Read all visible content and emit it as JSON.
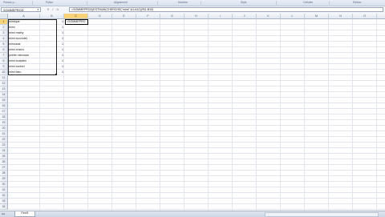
{
  "ribbon": {
    "groups": [
      "Presse-p...",
      "Police",
      "Alignement",
      "Nombre",
      "Style",
      "Cellules",
      "Édition"
    ]
  },
  "formula_bar": {
    "name_box": "SOMMEPROD",
    "formula": "=SOMMEPROD(ESTNUM(CHERCHE(\"mimi\";A1:A10))*B1:B10)",
    "icons": [
      "cancel-icon",
      "enter-icon",
      "function-icon"
    ]
  },
  "columns": [
    "A",
    "B",
    "C",
    "D",
    "E",
    "F",
    "G",
    "H",
    "I",
    "J",
    "K",
    "L",
    "M",
    "N",
    "O",
    "P",
    "Q",
    "R",
    "S"
  ],
  "rows": [
    "1",
    "2",
    "3",
    "4",
    "5",
    "6",
    "7",
    "8",
    "9",
    "10",
    "11",
    "12",
    "13",
    "14",
    "15",
    "16",
    "17",
    "18",
    "19",
    "20",
    "21",
    "22",
    "23",
    "24",
    "25",
    "26",
    "27",
    "28",
    "29",
    "30",
    "31",
    "32",
    "33",
    "34"
  ],
  "cells": [
    {
      "a": "mimique",
      "b": "1"
    },
    {
      "a": "mimi",
      "b": "1"
    },
    {
      "a": "mimi mathy",
      "b": "1"
    },
    {
      "a": "mimi cucciolini",
      "b": "1"
    },
    {
      "a": "mimosas",
      "b": "1"
    },
    {
      "a": "mimi cracra",
      "b": "1"
    },
    {
      "a": "yvette mimosas",
      "b": "1"
    },
    {
      "a": "mimi toutplein",
      "b": "1"
    },
    {
      "a": "mimi confort",
      "b": "1"
    },
    {
      "a": "mimi bleu",
      "b": "1"
    }
  ],
  "active_cell": {
    "ref": "C1",
    "content": "=SOMMEPRO"
  },
  "sheet": {
    "tab": "Feuil1",
    "nav": "◂ ▸"
  }
}
